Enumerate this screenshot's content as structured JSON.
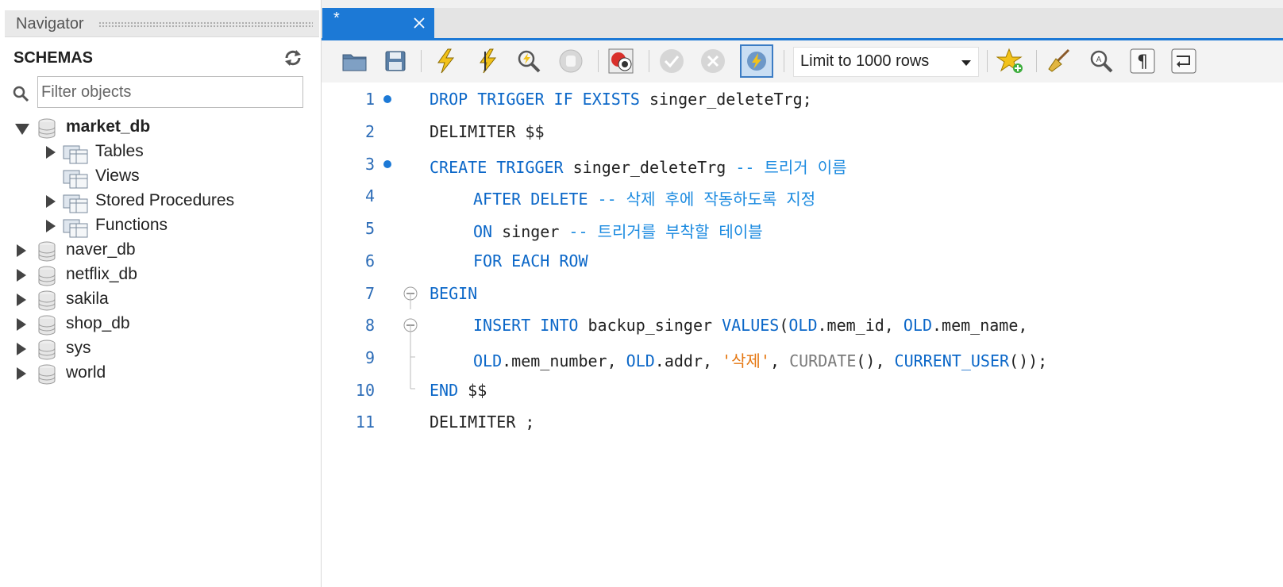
{
  "navigator": {
    "title": "Navigator",
    "schemas_label": "SCHEMAS",
    "filter_placeholder": "Filter objects",
    "schemas": [
      {
        "name": "market_db",
        "expanded": true,
        "children": [
          "Tables",
          "Views",
          "Stored Procedures",
          "Functions"
        ]
      },
      {
        "name": "naver_db",
        "expanded": false
      },
      {
        "name": "netflix_db",
        "expanded": false
      },
      {
        "name": "sakila",
        "expanded": false
      },
      {
        "name": "shop_db",
        "expanded": false
      },
      {
        "name": "sys",
        "expanded": false
      },
      {
        "name": "world",
        "expanded": false
      }
    ]
  },
  "editor": {
    "tab_label": "*",
    "limit_rows": "Limit to 1000 rows",
    "line_numbers": [
      "1",
      "2",
      "3",
      "4",
      "5",
      "6",
      "7",
      "8",
      "9",
      "10",
      "11"
    ],
    "tokens": {
      "l1": [
        "DROP TRIGGER IF EXISTS",
        " singer_deleteTrg;"
      ],
      "l2": [
        "DELIMITER $$"
      ],
      "l3": [
        "CREATE TRIGGER",
        " singer_deleteTrg ",
        "-- 트리거 이름"
      ],
      "l4": [
        "AFTER DELETE",
        " ",
        "-- 삭제 후에 작동하도록 지정"
      ],
      "l5": [
        "ON",
        " singer ",
        "-- 트리거를 부착할 테이블"
      ],
      "l6": [
        "FOR EACH ROW"
      ],
      "l7": [
        "BEGIN"
      ],
      "l8": [
        "INSERT INTO",
        " backup_singer ",
        "VALUES",
        "(",
        "OLD",
        ".mem_id, ",
        "OLD",
        ".mem_name,"
      ],
      "l9": [
        "OLD",
        ".mem_number, ",
        "OLD",
        ".addr, ",
        "'삭제'",
        ", ",
        "CURDATE",
        "(), ",
        "CURRENT_USER",
        "());"
      ],
      "l10": [
        "END",
        " $$"
      ],
      "l11": [
        "DELIMITER ;"
      ]
    }
  },
  "colors": {
    "accent": "#1c79d6",
    "keyword": "#0b67c8",
    "comment": "#1c8be0",
    "string": "#e5760f",
    "line_number": "#2c6cb7"
  }
}
